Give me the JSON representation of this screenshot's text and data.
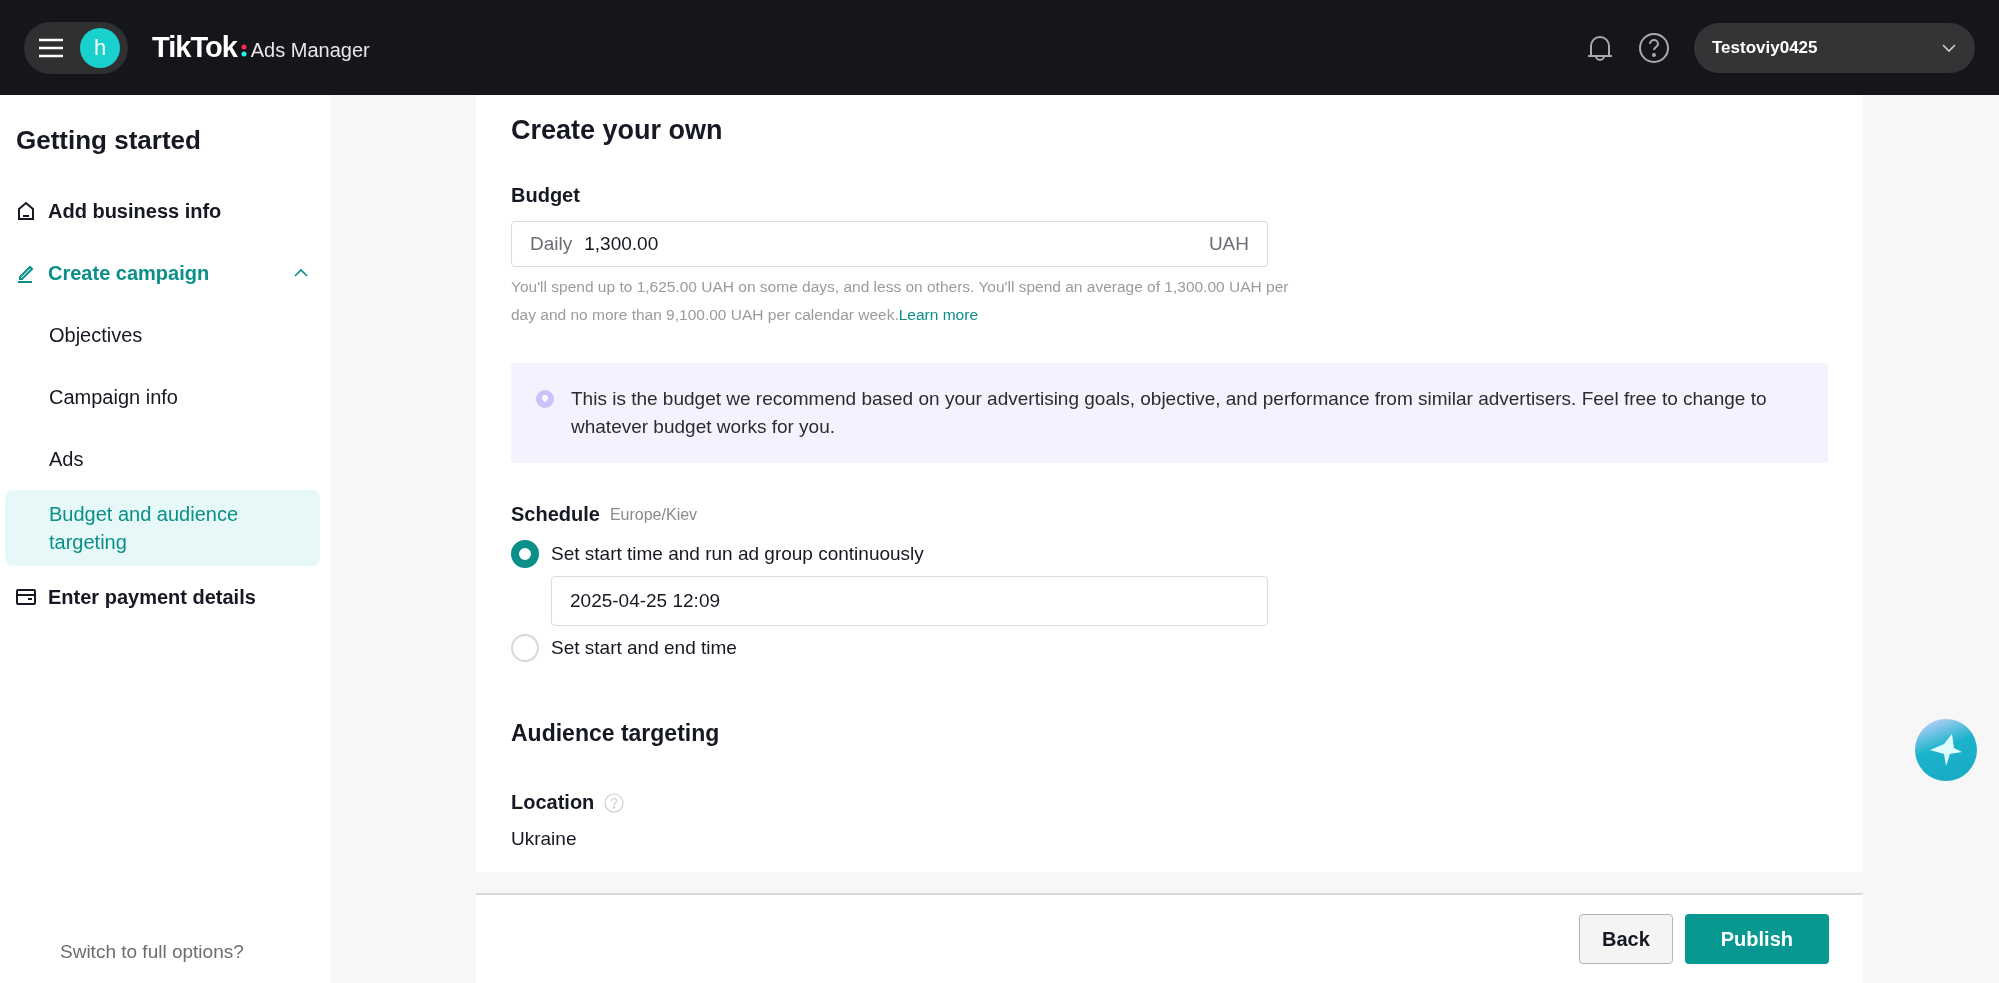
{
  "header": {
    "avatar_letter": "h",
    "brand": "TikTok",
    "product": "Ads Manager",
    "account": "Testoviy0425"
  },
  "sidebar": {
    "title": "Getting started",
    "items": [
      {
        "label": "Add business info",
        "kind": "home",
        "active": false
      },
      {
        "label": "Create campaign",
        "kind": "pencil",
        "active": true,
        "expanded": true,
        "children": [
          {
            "label": "Objectives",
            "selected": false
          },
          {
            "label": "Campaign info",
            "selected": false
          },
          {
            "label": "Ads",
            "selected": false
          },
          {
            "label": "Budget and audience targeting",
            "selected": true
          }
        ]
      },
      {
        "label": "Enter payment details",
        "kind": "card",
        "active": false
      }
    ],
    "footer_link": "Switch to full options?"
  },
  "form": {
    "title": "Create your own",
    "budget": {
      "label": "Budget",
      "prefix": "Daily",
      "value": "1,300.00",
      "suffix": "UAH",
      "hint": "You'll spend up to 1,625.00 UAH on some days, and less on others. You'll spend an average of 1,300.00 UAH per day and no more than 9,100.00 UAH per calendar week.",
      "hint_link": "Learn more"
    },
    "tip": "This is the budget we recommend based on your advertising goals, objective, and performance from similar advertisers. Feel free to change to whatever budget works for you.",
    "schedule": {
      "label": "Schedule",
      "timezone": "Europe/Kiev",
      "options": [
        {
          "label": "Set start time and run ad group continuously",
          "selected": true,
          "value": "2025-04-25 12:09"
        },
        {
          "label": "Set start and end time",
          "selected": false
        }
      ]
    },
    "audience": {
      "title": "Audience targeting",
      "location_label": "Location",
      "location_value": "Ukraine"
    }
  },
  "footer": {
    "buttons": [
      {
        "label": "Back",
        "kind": "secondary"
      },
      {
        "label": "Publish",
        "kind": "primary"
      }
    ]
  }
}
